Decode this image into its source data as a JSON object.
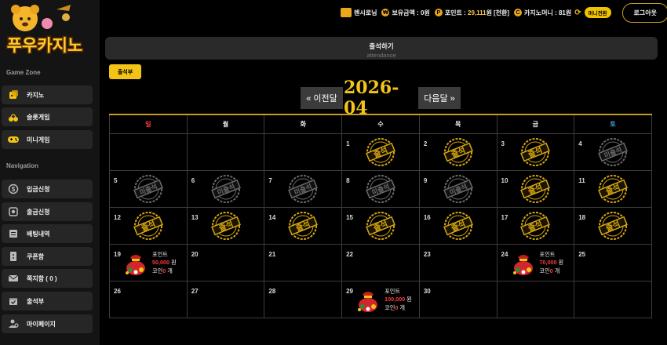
{
  "logo_text": "푸우카지노",
  "sidebar": {
    "sections": [
      {
        "title": "Game Zone",
        "items": [
          {
            "label": "카지노",
            "icon": "casino-icon"
          },
          {
            "label": "슬롯게임",
            "icon": "cherry-icon"
          },
          {
            "label": "미니게임",
            "icon": "gamepad-icon"
          }
        ]
      },
      {
        "title": "Navigation",
        "items": [
          {
            "label": "입금신청",
            "icon": "deposit-icon"
          },
          {
            "label": "출금신청",
            "icon": "withdraw-icon"
          },
          {
            "label": "배팅내역",
            "icon": "betting-list-icon"
          },
          {
            "label": "쿠폰함",
            "icon": "coupon-icon"
          },
          {
            "label": "쪽지함 ( 0 )",
            "icon": "mail-icon"
          },
          {
            "label": "출석부",
            "icon": "calendar-check-icon"
          },
          {
            "label": "마이페이지",
            "icon": "user-gear-icon"
          }
        ]
      }
    ]
  },
  "topbar": {
    "user": "렌시로님",
    "balance_label": "보유금액 :",
    "balance_value": "0원",
    "points_label": "포인트 :",
    "points_value": "29,111",
    "points_unit": "원",
    "convert_label": "[전환]",
    "casino_money_label": "카지노머니 :",
    "casino_money_value": "81원",
    "money_convert_btn": "머니전환",
    "login_btn": "로그아웃"
  },
  "header": {
    "title": "출석하기",
    "subtitle": "attendance"
  },
  "tab_label": "출석부",
  "nav": {
    "prev": "« 이전달",
    "next": "다음달 »",
    "current": "2026-04"
  },
  "colors": {
    "accent": "#f3c315",
    "sunday": "#ff3b3b",
    "saturday": "#4aa3df"
  },
  "stamp_texts": {
    "attended": "출석",
    "absent": "미출석"
  },
  "calendar": {
    "weekdays": [
      "일",
      "월",
      "화",
      "수",
      "목",
      "금",
      "토"
    ],
    "weeks": [
      [
        {
          "day": ""
        },
        {
          "day": ""
        },
        {
          "day": ""
        },
        {
          "day": "1",
          "stamp": "attended"
        },
        {
          "day": "2",
          "stamp": "attended"
        },
        {
          "day": "3",
          "stamp": "attended"
        },
        {
          "day": "4",
          "stamp": "absent"
        }
      ],
      [
        {
          "day": "5",
          "stamp": "absent"
        },
        {
          "day": "6",
          "stamp": "absent"
        },
        {
          "day": "7",
          "stamp": "absent"
        },
        {
          "day": "8",
          "stamp": "absent"
        },
        {
          "day": "9",
          "stamp": "absent"
        },
        {
          "day": "10",
          "stamp": "attended"
        },
        {
          "day": "11",
          "stamp": "attended"
        }
      ],
      [
        {
          "day": "12",
          "stamp": "attended"
        },
        {
          "day": "13",
          "stamp": "attended"
        },
        {
          "day": "14",
          "stamp": "attended"
        },
        {
          "day": "15",
          "stamp": "attended"
        },
        {
          "day": "16",
          "stamp": "attended"
        },
        {
          "day": "17",
          "stamp": "attended"
        },
        {
          "day": "18",
          "stamp": "attended"
        }
      ],
      [
        {
          "day": "19",
          "reward": {
            "label": "포인트",
            "amount": "50,000",
            "unit": "원",
            "coin_label": "코인",
            "coin_count": "0",
            "coin_unit": "개"
          }
        },
        {
          "day": "20"
        },
        {
          "day": "21"
        },
        {
          "day": "22"
        },
        {
          "day": "23"
        },
        {
          "day": "24",
          "reward": {
            "label": "포인트",
            "amount": "70,000",
            "unit": "원",
            "coin_label": "코인",
            "coin_count": "0",
            "coin_unit": "개"
          }
        },
        {
          "day": "25"
        }
      ],
      [
        {
          "day": "26"
        },
        {
          "day": "27"
        },
        {
          "day": "28"
        },
        {
          "day": "29",
          "reward": {
            "label": "포인트",
            "amount": "100,000",
            "unit": "원",
            "coin_label": "코인",
            "coin_count": "0",
            "coin_unit": "개"
          }
        },
        {
          "day": "30"
        },
        {
          "day": ""
        },
        {
          "day": ""
        }
      ]
    ]
  }
}
